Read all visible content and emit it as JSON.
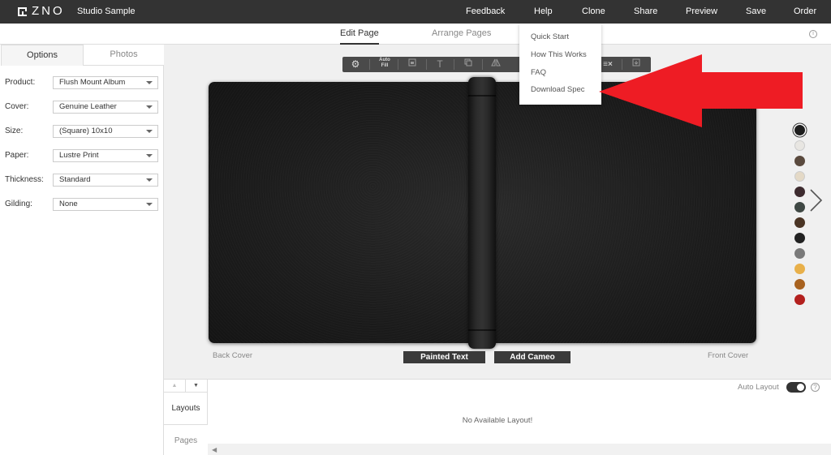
{
  "header": {
    "logo_text": "ZNO",
    "studio_name": "Studio Sample",
    "nav": [
      "Feedback",
      "Help",
      "Clone",
      "Share",
      "Preview",
      "Save",
      "Order"
    ]
  },
  "subbar": {
    "tabs": [
      "Edit Page",
      "Arrange Pages"
    ],
    "active_tab": "Edit Page",
    "info_icon": "i"
  },
  "left_panel": {
    "tabs": [
      "Options",
      "Photos"
    ],
    "active_tab": "Options",
    "options": [
      {
        "label": "Product:",
        "value": "Flush Mount Album"
      },
      {
        "label": "Cover:",
        "value": "Genuine Leather"
      },
      {
        "label": "Size:",
        "value": "(Square) 10x10"
      },
      {
        "label": "Paper:",
        "value": "Lustre Print"
      },
      {
        "label": "Thickness:",
        "value": "Standard"
      },
      {
        "label": "Gilding:",
        "value": "None"
      }
    ]
  },
  "toolbar": {
    "autofill_label_top": "Auto",
    "autofill_label_bottom": "Fill",
    "icons": [
      "gear-icon",
      "auto-fill-icon",
      "image-frame-icon",
      "text-icon",
      "copy-icon",
      "mirror-icon",
      "clear-text-icon",
      "export-icon"
    ]
  },
  "help_menu": {
    "items": [
      "Quick Start",
      "How This Works",
      "FAQ",
      "Download Spec"
    ]
  },
  "canvas": {
    "back_cover_label": "Back Cover",
    "front_cover_label": "Front Cover",
    "painted_text_label": "Painted Text",
    "add_cameo_label": "Add Cameo",
    "cover_color": "#1e1e1e"
  },
  "swatches": {
    "colors": [
      "#1e1e1e",
      "#e8e6e2",
      "#5a4a3e",
      "#e4d9c6",
      "#3d2b2f",
      "#3f4844",
      "#4a3424",
      "#222222",
      "#7a7a7a",
      "#e8b04a",
      "#a8621f",
      "#b3201e"
    ],
    "selected_index": 0
  },
  "annotation": {
    "arrow_color": "#ee1c24"
  },
  "bottom_panel": {
    "up_arrow": "▲",
    "down_arrow": "▼",
    "tabs": [
      "Layouts",
      "Pages"
    ],
    "auto_layout_label": "Auto Layout",
    "auto_layout_on": true,
    "help_icon": "?",
    "empty_message": "No Available Layout!",
    "scroll_left": "◀"
  }
}
